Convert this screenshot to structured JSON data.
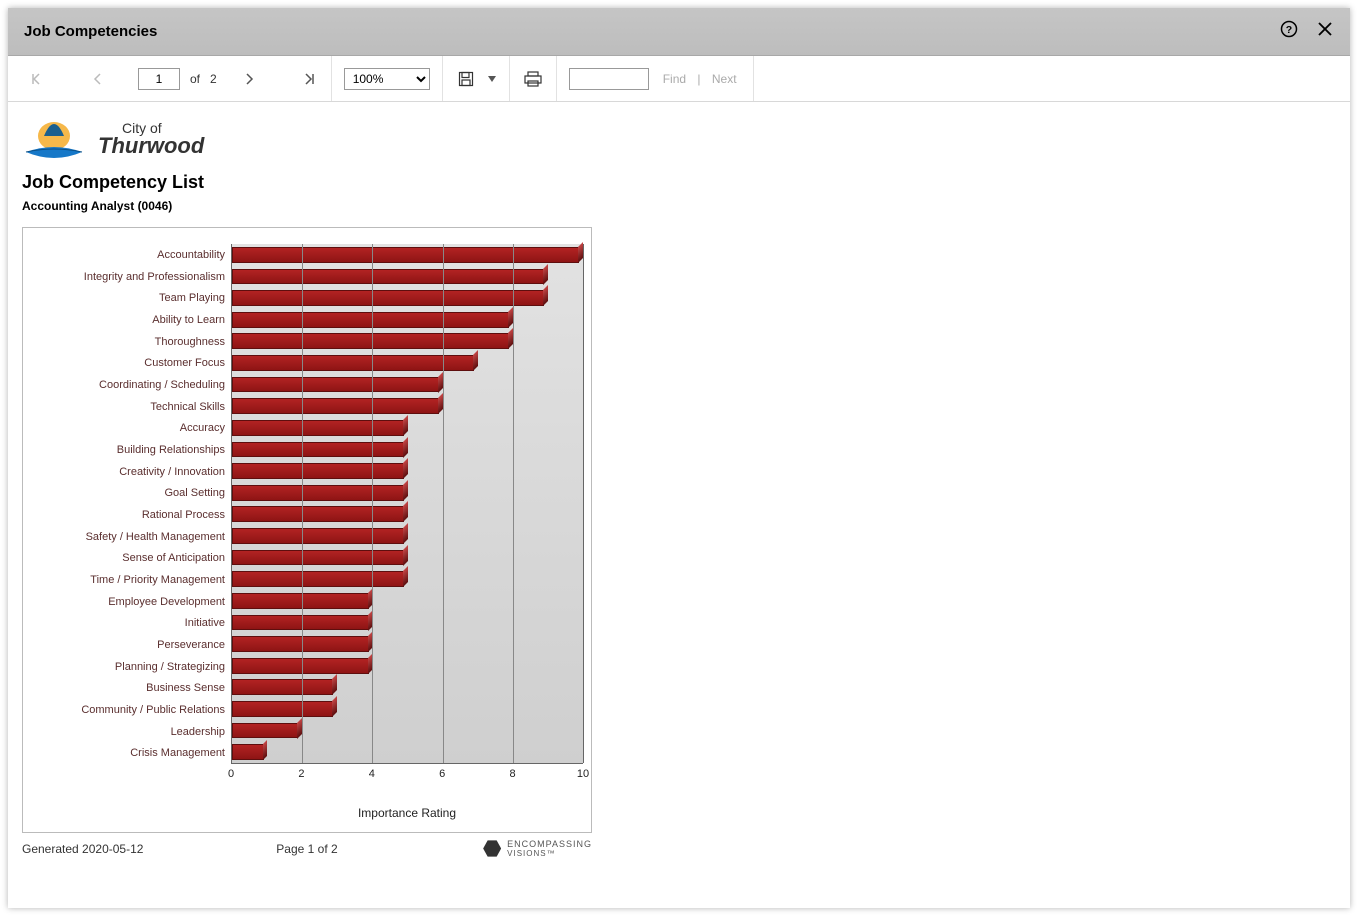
{
  "window": {
    "title": "Job Competencies"
  },
  "toolbar": {
    "page_current": "1",
    "page_of_label": "of",
    "page_total": "2",
    "zoom": "100%",
    "find_label": "Find",
    "next_label": "Next"
  },
  "org": {
    "line1": "City of",
    "line2": "Thurwood"
  },
  "report": {
    "title": "Job Competency List",
    "subtitle": "Accounting Analyst (0046)"
  },
  "chart_data": {
    "type": "bar",
    "orientation": "horizontal",
    "xlabel": "Importance Rating",
    "xlim": [
      0,
      10
    ],
    "x_ticks": [
      0,
      2,
      4,
      6,
      8,
      10
    ],
    "categories": [
      "Accountability",
      "Integrity and Professionalism",
      "Team Playing",
      "Ability to Learn",
      "Thoroughness",
      "Customer Focus",
      "Coordinating / Scheduling",
      "Technical Skills",
      "Accuracy",
      "Building Relationships",
      "Creativity / Innovation",
      "Goal Setting",
      "Rational Process",
      "Safety / Health Management",
      "Sense of Anticipation",
      "Time / Priority Management",
      "Employee Development",
      "Initiative",
      "Perseverance",
      "Planning / Strategizing",
      "Business Sense",
      "Community / Public Relations",
      "Leadership",
      "Crisis Management"
    ],
    "values": [
      10,
      9,
      9,
      8,
      8,
      7,
      6,
      6,
      5,
      5,
      5,
      5,
      5,
      5,
      5,
      5,
      4,
      4,
      4,
      4,
      3,
      3,
      2,
      1
    ]
  },
  "footer": {
    "generated": "Generated 2020-05-12",
    "page": "Page 1 of 2",
    "vendor_line1": "ENCOMPASSING",
    "vendor_line2": "VISIONS™"
  }
}
